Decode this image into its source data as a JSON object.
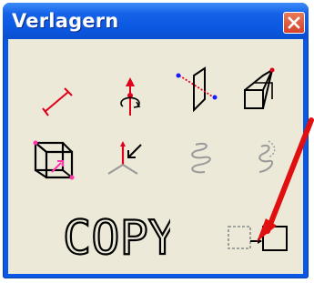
{
  "window": {
    "title": "Verlagern"
  },
  "tools": [
    {
      "name": "move-line-tool",
      "icon": "move-line-icon"
    },
    {
      "name": "rotate-tool",
      "icon": "rotate-axis-icon"
    },
    {
      "name": "mirror-plane-tool",
      "icon": "mirror-plane-icon"
    },
    {
      "name": "project-box-tool",
      "icon": "project-box-icon"
    },
    {
      "name": "box-transform-tool",
      "icon": "box-transform-icon"
    },
    {
      "name": "axis-move-tool",
      "icon": "axis-move-icon"
    },
    {
      "name": "spiral-tool",
      "icon": "spiral-icon",
      "disabled": true
    },
    {
      "name": "path-sweep-tool",
      "icon": "path-sweep-icon",
      "disabled": true
    },
    {
      "name": "copy-move-tool",
      "icon": "copy-boxes-icon"
    }
  ],
  "copy_label": "COPY",
  "colors": {
    "titlebar": "#0a58e6",
    "client": "#ece9d8",
    "accent_red": "#e0001a",
    "annotation_arrow": "#e01010",
    "disabled_gray": "#9a9a9a"
  }
}
